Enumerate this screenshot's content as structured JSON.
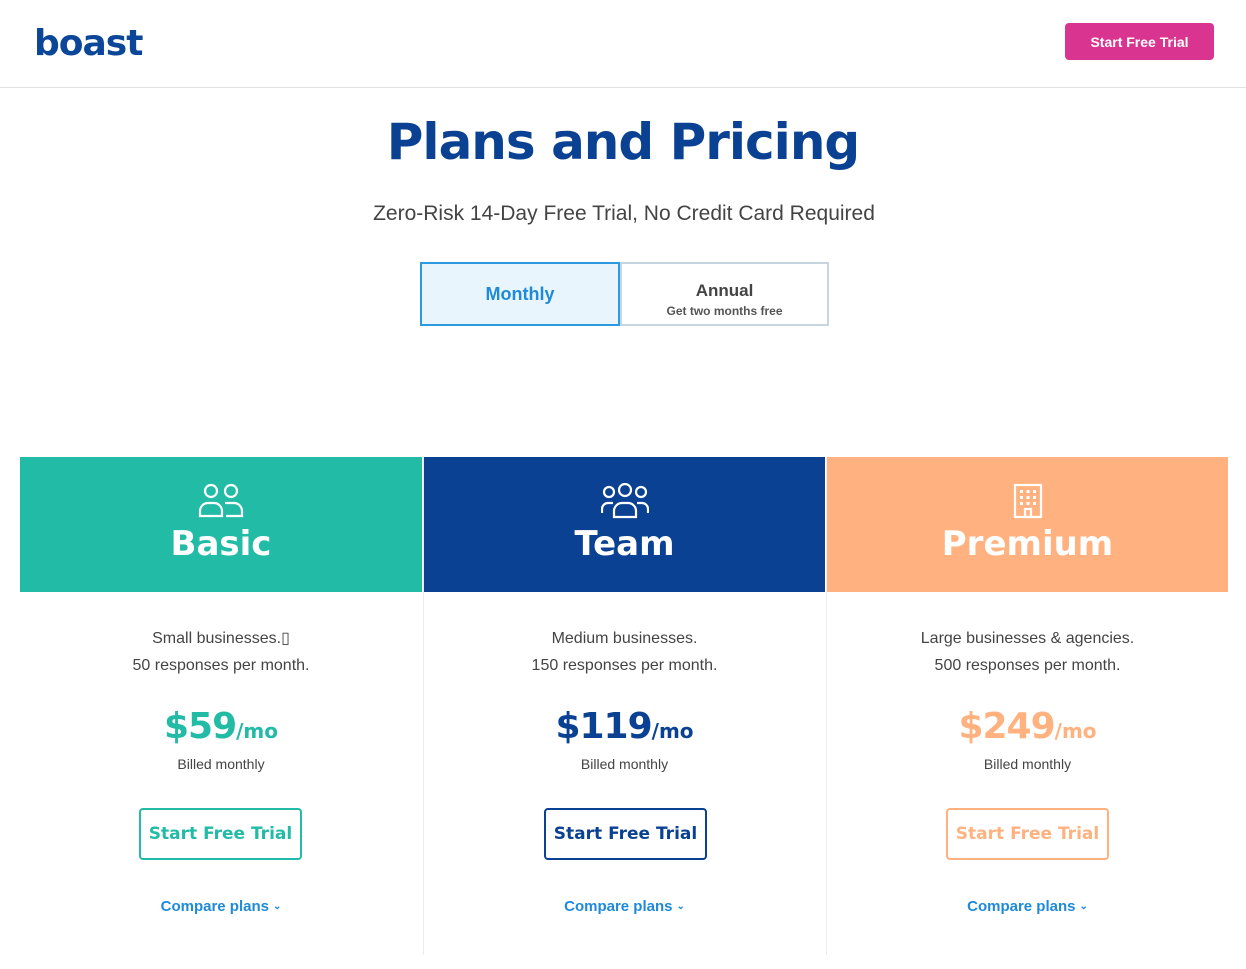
{
  "header": {
    "logo": "boast",
    "cta_label": "Start Free Trial"
  },
  "hero": {
    "title": "Plans and Pricing",
    "subtitle": "Zero-Risk 14-Day Free Trial, No Credit Card Required"
  },
  "billing_toggle": {
    "monthly_label": "Monthly",
    "annual_label": "Annual",
    "annual_sublabel": "Get two months free",
    "selected": "Monthly"
  },
  "plans": [
    {
      "name": "Basic",
      "icon": "two-users-icon",
      "color": "#22bba6",
      "desc_line1": "Small businesses.▯",
      "desc_line2": "50 responses per month.",
      "price": "$59",
      "per": "/mo",
      "billed": "Billed monthly",
      "cta": "Start Free Trial",
      "compare": "Compare plans"
    },
    {
      "name": "Team",
      "icon": "three-users-icon",
      "color": "#0b4192",
      "desc_line1": "Medium businesses.",
      "desc_line2": "150 responses per month.",
      "price": "$119",
      "per": "/mo",
      "billed": "Billed monthly",
      "cta": "Start Free Trial",
      "compare": "Compare plans"
    },
    {
      "name": "Premium",
      "icon": "building-icon",
      "color": "#ffb27f",
      "desc_line1": "Large businesses & agencies.",
      "desc_line2": "500 responses per month.",
      "price": "$249",
      "per": "/mo",
      "billed": "Billed monthly",
      "cta": "Start Free Trial",
      "compare": "Compare plans"
    }
  ],
  "colors": {
    "brand_blue": "#0b4192",
    "cta_pink": "#d9348f",
    "link_blue": "#1f8ad8",
    "band_bg": "#e2effe"
  }
}
